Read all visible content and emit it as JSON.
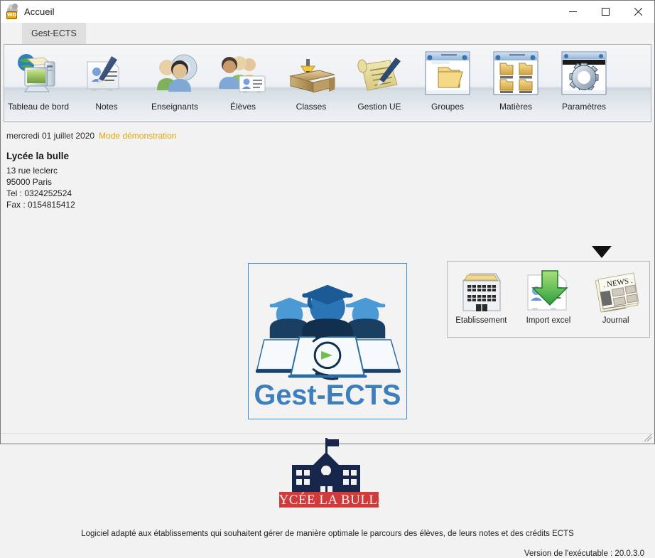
{
  "window": {
    "title": "Accueil",
    "app_icon": "windev-icon",
    "controls": {
      "minimize": "minimize-icon",
      "maximize": "maximize-icon",
      "close": "close-icon"
    }
  },
  "tabstrip": {
    "tabs": [
      {
        "label": "Gest-ECTS",
        "active": true
      }
    ]
  },
  "ribbon": {
    "items": [
      {
        "label": "Tableau de bord",
        "icon": "dashboard-computer-icon"
      },
      {
        "label": "Notes",
        "icon": "notes-pen-icon"
      },
      {
        "label": "Enseignants",
        "icon": "teachers-gear-icon"
      },
      {
        "label": "Élèves",
        "icon": "students-badge-icon"
      },
      {
        "label": "Classes",
        "icon": "classroom-desk-icon"
      },
      {
        "label": "Gestion UE",
        "icon": "scroll-pen-icon"
      },
      {
        "label": "Groupes",
        "icon": "window-folder-icon"
      },
      {
        "label": "Matières",
        "icon": "window-folders-icon"
      },
      {
        "label": "Paramètres",
        "icon": "window-gear-icon"
      }
    ],
    "expanded_item": "Paramètres"
  },
  "info": {
    "date": "mercredi 01 juillet 2020",
    "mode": "Mode démonstration",
    "school_name": "Lycée la bulle",
    "address_street": "13 rue leclerc",
    "address_city": "95000 Paris",
    "phone": "Tel : 0324252524",
    "fax": "Fax : 0154815412"
  },
  "logo": {
    "product_name": "Gest-ECTS",
    "school_banner": "LYCÉE LA BULLE"
  },
  "submenu": {
    "items": [
      {
        "label": "Etablissement",
        "icon": "building-icon"
      },
      {
        "label": "Import excel",
        "icon": "import-download-icon"
      },
      {
        "label": "Journal",
        "icon": "newspaper-icon"
      }
    ]
  },
  "footer": {
    "tagline": "Logiciel adapté aux établissements qui souhaitent gérer de manière optimale le parcours des élèves, de leurs notes et des crédits ECTS",
    "version": "Version de l'exécutable : 20.0.3.0"
  },
  "colors": {
    "accent_blue": "#3c91e0",
    "logo_dark_blue": "#1a3a5c",
    "logo_mid_blue": "#2b74b5",
    "banner_red": "#cf3b3b",
    "demo_orange": "#e0a800",
    "ribbon_border": "#a9b4bd"
  }
}
